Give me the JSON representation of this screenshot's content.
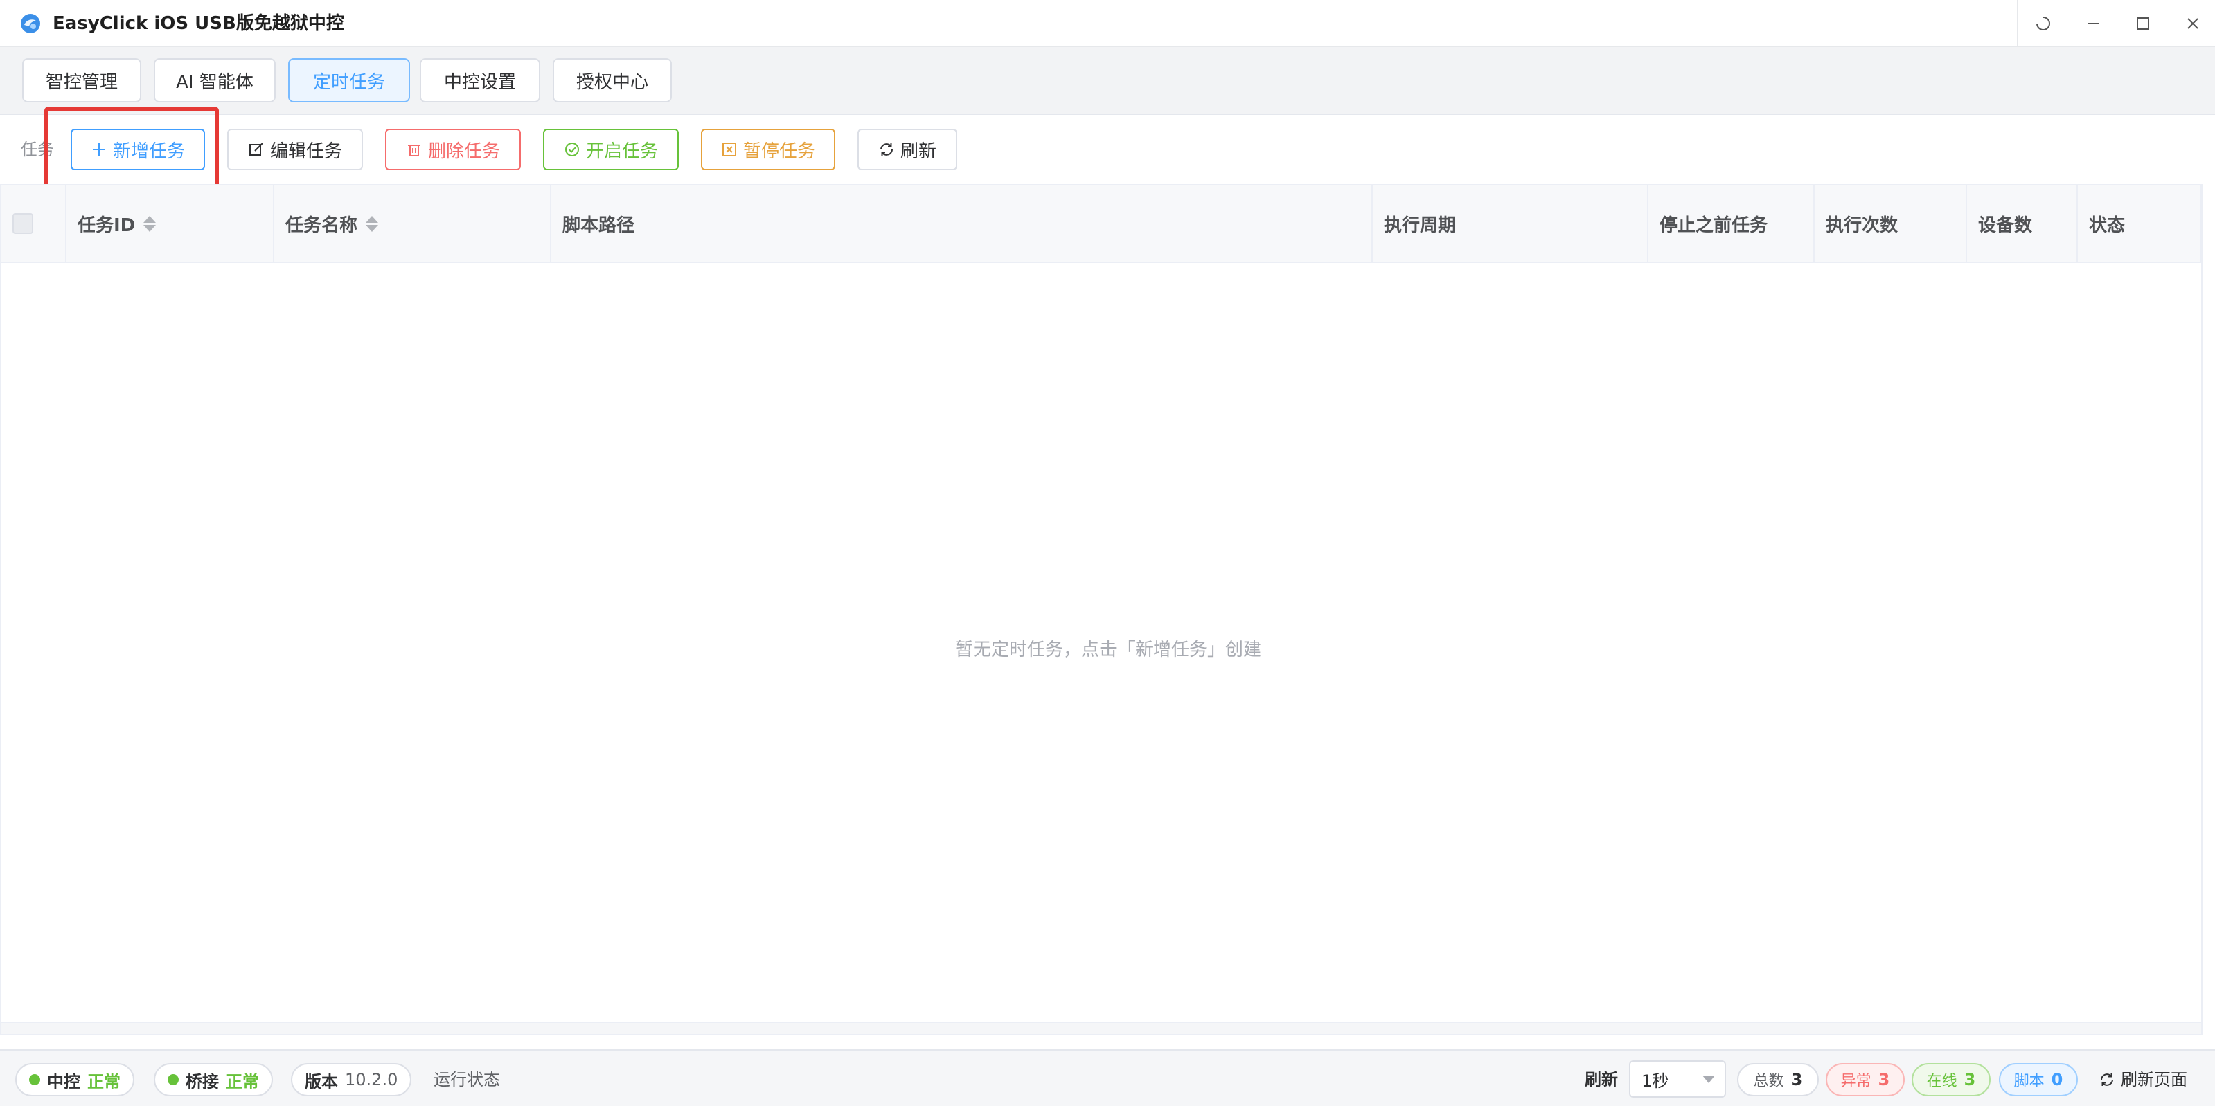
{
  "window": {
    "title": "EasyClick iOS USB版免越狱中控",
    "controls": [
      "loading-icon",
      "minimize-icon",
      "maximize-icon",
      "close-icon"
    ]
  },
  "nav": {
    "tabs": [
      {
        "label": "智控管理",
        "active": false
      },
      {
        "label": "AI 智能体",
        "active": false
      },
      {
        "label": "定时任务",
        "active": true
      },
      {
        "label": "中控设置",
        "active": false
      },
      {
        "label": "授权中心",
        "active": false
      }
    ]
  },
  "toolbar": {
    "label": "任务",
    "add": "新增任务",
    "edit": "编辑任务",
    "delete": "删除任务",
    "start": "开启任务",
    "pause": "暂停任务",
    "refresh": "刷新"
  },
  "table": {
    "columns": [
      "任务ID",
      "任务名称",
      "脚本路径",
      "执行周期",
      "停止之前任务",
      "执行次数",
      "设备数",
      "状态"
    ],
    "rows": [],
    "empty_text": "暂无定时任务，点击「新增任务」创建"
  },
  "statusbar": {
    "control": {
      "label": "中控",
      "status": "正常"
    },
    "bridge": {
      "label": "桥接",
      "status": "正常"
    },
    "version": {
      "label": "版本",
      "value": "10.2.0"
    },
    "run_state": "运行状态",
    "refresh_label": "刷新",
    "refresh_interval": "1秒",
    "total": {
      "label": "总数",
      "value": "3"
    },
    "error": {
      "label": "异常",
      "value": "3"
    },
    "online": {
      "label": "在线",
      "value": "3"
    },
    "script": {
      "label": "脚本",
      "value": "0"
    },
    "refresh_page": "刷新页面"
  },
  "colors": {
    "primary": "#409eff",
    "danger": "#f56c6c",
    "success": "#67c23a",
    "warning": "#e6a23c",
    "highlight": "#e53935"
  }
}
